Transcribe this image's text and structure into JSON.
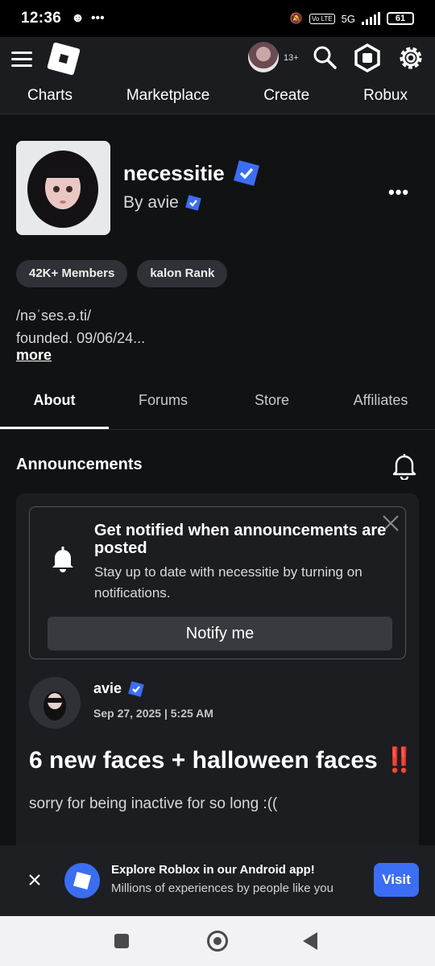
{
  "status_bar": {
    "time": "12:36",
    "network": "5G",
    "battery": "61"
  },
  "top_nav": {
    "age_badge": "13+",
    "tabs": [
      "Charts",
      "Marketplace",
      "Create",
      "Robux"
    ]
  },
  "group": {
    "name": "necessitie",
    "owner": "By avie",
    "chips": [
      "42K+ Members",
      "kalon Rank"
    ],
    "description_line1": "/nəˈses.ə.ti/",
    "description_line2": "founded. 09/06/24...",
    "more_label": "more"
  },
  "tabs": [
    "About",
    "Forums",
    "Store",
    "Affiliates"
  ],
  "announcements": {
    "title": "Announcements",
    "notify_title": "Get notified when announcements are posted",
    "notify_text": "Stay up to date with necessitie by turning on notifications.",
    "notify_button": "Notify me",
    "post": {
      "author": "avie",
      "date": "Sep 27, 2025 | 5:25 AM",
      "title": "6 new faces + halloween faces ‼️",
      "body": "sorry for being inactive for so long :(("
    }
  },
  "app_banner": {
    "title": "Explore Roblox in our Android app!",
    "subtitle": "Millions of experiences by people like you",
    "button": "Visit"
  },
  "colors": {
    "background": "#111214",
    "verified_blue": "#3b6ef5",
    "card": "#1c1d21"
  }
}
